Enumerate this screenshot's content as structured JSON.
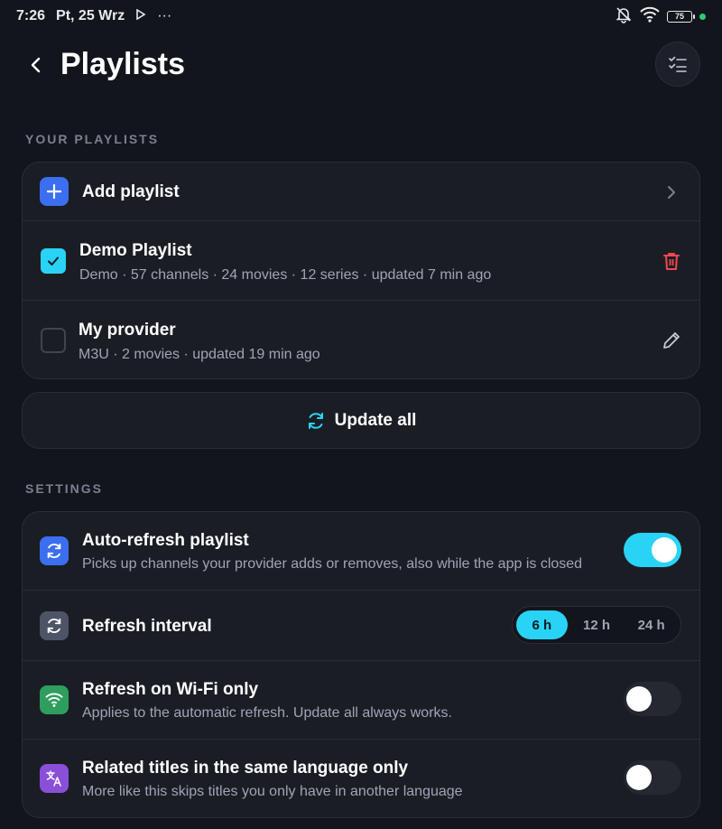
{
  "status": {
    "time": "7:26",
    "date": "Pt, 25 Wrz",
    "more": "···",
    "battery": "75"
  },
  "header": {
    "title": "Playlists"
  },
  "playlists_section": {
    "label": "YOUR PLAYLISTS",
    "add_label": "Add playlist",
    "items": [
      {
        "name": "Demo Playlist",
        "meta": "Demo · 57 channels · 24 movies · 12 series · updated 7 min ago",
        "checked": true,
        "action": "trash-icon"
      },
      {
        "name": "My provider",
        "meta": "M3U · 2 movies · updated 19 min ago",
        "checked": false,
        "action": "pencil-icon"
      }
    ],
    "update_all_label": "Update all"
  },
  "settings_section": {
    "label": "SETTINGS",
    "auto_refresh": {
      "title": "Auto-refresh playlist",
      "subtitle": "Picks up channels your provider adds or removes, also while the app is closed",
      "enabled": true
    },
    "refresh_interval": {
      "title": "Refresh interval",
      "options": [
        "6 h",
        "12 h",
        "24 h"
      ],
      "selected": "6 h"
    },
    "wifi_only": {
      "title": "Refresh on Wi-Fi only",
      "subtitle": "Applies to the automatic refresh. Update all always works.",
      "enabled": false
    },
    "same_language": {
      "title": "Related titles in the same language only",
      "subtitle": "More like this skips titles you only have in another language",
      "enabled": false
    }
  },
  "colors": {
    "accent": "#29d3f5",
    "danger": "#f0474f",
    "background": "#13151c",
    "card": "#1b1d25"
  }
}
